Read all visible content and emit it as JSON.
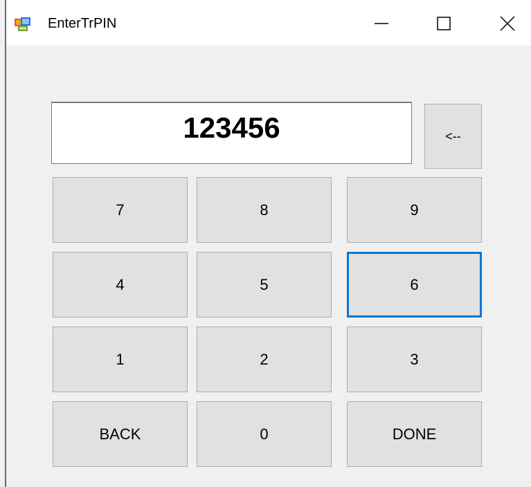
{
  "window": {
    "title": "EnterTrPIN"
  },
  "display": {
    "value": "123456"
  },
  "keys": {
    "backspace": "<--",
    "k7": "7",
    "k8": "8",
    "k9": "9",
    "k4": "4",
    "k5": "5",
    "k6": "6",
    "k1": "1",
    "k2": "2",
    "k3": "3",
    "back": "BACK",
    "k0": "0",
    "done": "DONE"
  },
  "colors": {
    "focus": "#0078d7",
    "button_face": "#e1e1e1",
    "window_bg": "#f0f0f0"
  }
}
